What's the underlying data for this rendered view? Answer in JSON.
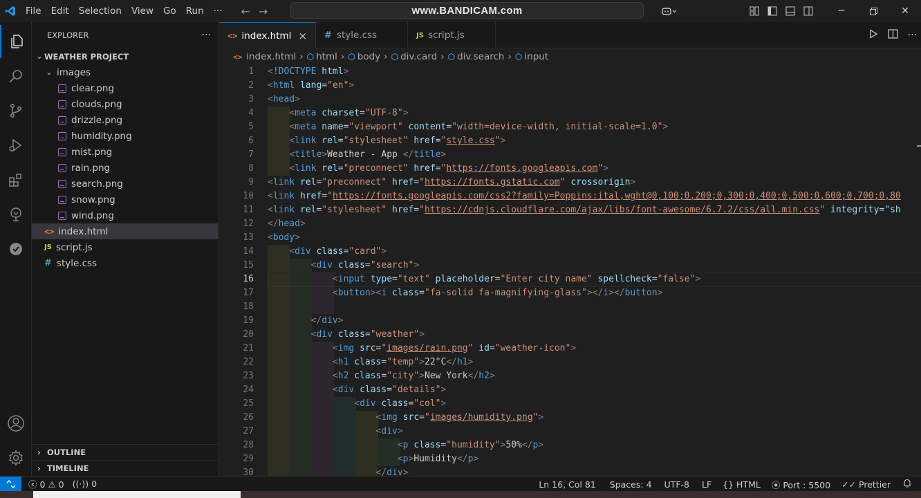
{
  "titlebar": {
    "menu": [
      "File",
      "Edit",
      "Selection",
      "View",
      "Go",
      "Run",
      "···"
    ],
    "command_center": "www.BANDICAM.com",
    "accent": "#0078d4"
  },
  "activity_bar": {
    "icons": [
      "explorer-icon",
      "search-icon",
      "source-control-icon",
      "run-debug-icon",
      "extensions-icon",
      "remote-explorer-icon",
      "testing-icon",
      "accounts-icon",
      "manage-gear-icon"
    ]
  },
  "sidebar": {
    "title": "EXPLORER",
    "more": "···",
    "project": "WEATHER PROJECT",
    "folder": "images",
    "images": [
      "clear.png",
      "clouds.png",
      "drizzle.png",
      "humidity.png",
      "mist.png",
      "rain.png",
      "search.png",
      "snow.png",
      "wind.png"
    ],
    "files": [
      {
        "name": "index.html",
        "icon_text": "<>"
      },
      {
        "name": "script.js",
        "icon_text": "JS"
      },
      {
        "name": "style.css",
        "icon_text": "#"
      }
    ],
    "outline": "OUTLINE",
    "timeline": "TIMELINE"
  },
  "tabs": [
    {
      "label": "index.html",
      "icon_text": "<>",
      "close": "×"
    },
    {
      "label": "style.css",
      "icon_text": "#"
    },
    {
      "label": "script.js",
      "icon_text": "JS"
    }
  ],
  "breadcrumb": [
    "index.html",
    "html",
    "body",
    "div.card",
    "div.search",
    "input"
  ],
  "editor": {
    "line_numbers": [
      "1",
      "2",
      "3",
      "4",
      "5",
      "6",
      "7",
      "8",
      "9",
      "10",
      "11",
      "12",
      "13",
      "14",
      "15",
      "16",
      "17",
      "18",
      "19",
      "20",
      "21",
      "22",
      "23",
      "24",
      "25",
      "26",
      "27",
      "28",
      "29",
      "30"
    ],
    "current_line": "16"
  },
  "code_text": {
    "l1_tag": "!DOCTYPE",
    "l1_attr": "html",
    "viewport_content": "width=device-width, initial-scale=1.0",
    "title_text": "Weather - App ",
    "url_gapi": "https://fonts.googleapis.com",
    "url_gstatic": "https://fonts.gstatic.com",
    "url_fonts_css": "https://fonts.googleapis.com/css2?family=Poppins:ital,wght@0,100;0,200;0,300;0,400;0,500;0,600;0,700;0,80",
    "url_fa": "https://cdnjs.cloudflare.com/ajax/libs/font-awesome/6.7.2/css/all.min.css",
    "integrity_trunc": "integrity=\"sh",
    "placeholder": "Enter city name",
    "icon_class": "fa-solid fa-magnifying-glass",
    "img_rain": "images/rain.png",
    "weather_icon_id": "weather-icon",
    "temp": "22°C",
    "city": "New York",
    "img_humidity": "images/humidity.png",
    "humidity_val": "50%",
    "humidity_label": "Humidity"
  },
  "statusbar": {
    "errors": "0",
    "warnings": "0",
    "ports": "0",
    "position": "Ln 16, Col 81",
    "spaces": "Spaces: 4",
    "encoding": "UTF-8",
    "eol": "LF",
    "language": "HTML",
    "port": "Port : 5500",
    "prettier": "Prettier"
  }
}
